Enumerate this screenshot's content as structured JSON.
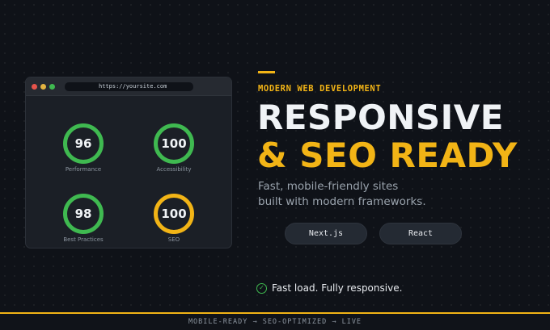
{
  "browser": {
    "url": "https://yoursite.com",
    "scores": [
      {
        "value": "96",
        "label": "Performance",
        "color": "#3fb950"
      },
      {
        "value": "100",
        "label": "Accessibility",
        "color": "#3fb950"
      },
      {
        "value": "98",
        "label": "Best Practices",
        "color": "#3fb950"
      },
      {
        "value": "100",
        "label": "SEO",
        "color": "#f2b416"
      }
    ]
  },
  "hero": {
    "eyebrow": "MODERN WEB DEVELOPMENT",
    "headline_line1": "RESPONSIVE",
    "headline_line2": "& SEO READY",
    "subtitle_line1": "Fast, mobile-friendly sites",
    "subtitle_line2": "built with modern frameworks.",
    "buttons": [
      "Next.js",
      "React"
    ],
    "check_text": "Fast load. Fully responsive.",
    "check_icon": "check-circle-icon"
  },
  "footer": {
    "text": "MOBILE-READY → SEO-OPTIMIZED → LIVE"
  },
  "colors": {
    "accent": "#f2b416",
    "success": "#3fb950",
    "background": "#0f1218"
  }
}
